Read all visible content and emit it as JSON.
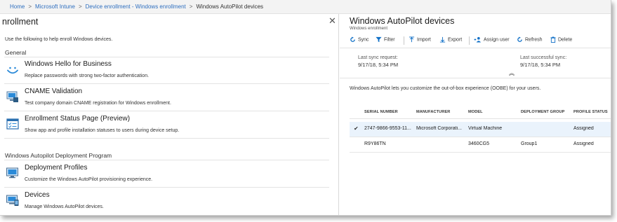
{
  "breadcrumb": {
    "items": [
      "Home",
      "Microsoft Intune",
      "Device enrollment - Windows enrollment"
    ],
    "current": "Windows AutoPilot devices",
    "separator": ">"
  },
  "left": {
    "title": "nrollment",
    "close_glyph": "✕",
    "intro": "Use the following to help enroll Windows devices.",
    "sections": [
      {
        "label": "General",
        "items": [
          {
            "icon": "windows-hello-icon",
            "title": "Windows Hello for Business",
            "desc": "Replace passwords with strong two-factor authentication."
          },
          {
            "icon": "cname-icon",
            "title": "CNAME Validation",
            "desc": "Test company domain CNAME registration for Windows enrollment."
          },
          {
            "icon": "enrollment-status-icon",
            "title": "Enrollment Status Page (Preview)",
            "desc": "Show app and profile installation statuses to users during device setup."
          }
        ]
      },
      {
        "label": "Windows Autopilot Deployment Program",
        "items": [
          {
            "icon": "deployment-profiles-icon",
            "title": "Deployment Profiles",
            "desc": "Customize the Windows AutoPilot provisioning experience."
          },
          {
            "icon": "devices-icon",
            "title": "Devices",
            "desc": "Manage Windows AutoPilot devices."
          }
        ]
      }
    ]
  },
  "right": {
    "title": "Windows AutoPilot devices",
    "subtitle": "Windows enrollment",
    "toolbar": {
      "sync": "Sync",
      "filter": "Filter",
      "import": "Import",
      "export": "Export",
      "assign_user": "Assign user",
      "refresh": "Refresh",
      "delete": "Delete"
    },
    "sync_info": {
      "last_request_label": "Last sync request:",
      "last_request_value": "9/17/18, 5:34 PM",
      "last_success_label": "Last successful sync:",
      "last_success_value": "9/17/18, 5:34 PM",
      "collapse_glyph": "︽"
    },
    "description": "Windows AutoPilot lets you customize the out-of-box experience (OOBE) for your users.",
    "table": {
      "columns": [
        "SERIAL NUMBER",
        "MANUFACTURER",
        "MODEL",
        "DEPLOYMENT GROUP",
        "PROFILE STATUS"
      ],
      "rows": [
        {
          "selected": true,
          "cells": [
            "2747-9866-9553-11...",
            "Microsoft Corporati...",
            "Virtual Machine",
            "",
            "Assigned"
          ]
        },
        {
          "selected": false,
          "cells": [
            "R9Y86TN",
            "",
            "3460CG5",
            "Group1",
            "Assigned"
          ]
        }
      ]
    }
  },
  "colors": {
    "accent": "#0f6fc6",
    "link": "#2f6fbf",
    "selected_row": "#eaf3fc"
  }
}
